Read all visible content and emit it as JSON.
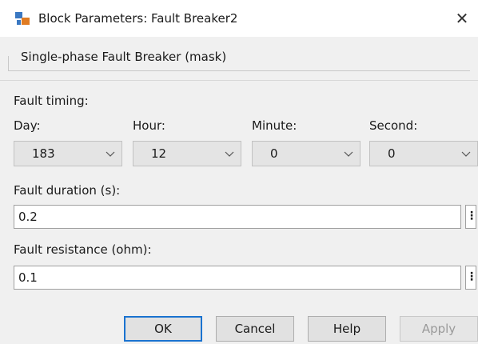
{
  "window": {
    "title": "Block Parameters: Fault Breaker2",
    "close_glyph": "✕",
    "icon": "simulink-block-icon"
  },
  "mask": {
    "title": "Single-phase Fault Breaker (mask)"
  },
  "fault_timing": {
    "label": "Fault timing:",
    "fields": [
      {
        "label": "Day:",
        "value": "183"
      },
      {
        "label": "Hour:",
        "value": "12"
      },
      {
        "label": "Minute:",
        "value": "0"
      },
      {
        "label": "Second:",
        "value": "0"
      }
    ]
  },
  "fault_duration": {
    "label": "Fault duration (s):",
    "value": "0.2",
    "more_glyph": "⋮"
  },
  "fault_resistance": {
    "label": "Fault resistance (ohm):",
    "value": "0.1",
    "more_glyph": "⋮"
  },
  "buttons": {
    "ok": "OK",
    "cancel": "Cancel",
    "help": "Help",
    "apply": "Apply"
  },
  "colors": {
    "accent": "#1a73d0"
  }
}
